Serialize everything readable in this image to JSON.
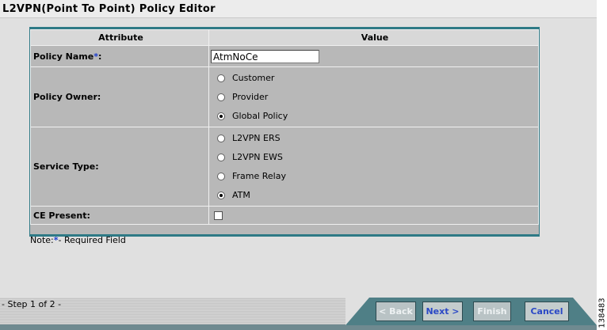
{
  "header": {
    "title": "L2VPN(Point To Point) Policy Editor"
  },
  "table": {
    "col_attribute": "Attribute",
    "col_value": "Value",
    "policy_name": {
      "label": "Policy Name",
      "required_mark": "*",
      "suffix": ":",
      "value": "AtmNoCe"
    },
    "policy_owner": {
      "label": "Policy Owner:",
      "options": [
        {
          "label": "Customer",
          "selected": false
        },
        {
          "label": "Provider",
          "selected": false
        },
        {
          "label": "Global Policy",
          "selected": true
        }
      ]
    },
    "service_type": {
      "label": "Service Type:",
      "options": [
        {
          "label": "L2VPN ERS",
          "selected": false
        },
        {
          "label": "L2VPN EWS",
          "selected": false
        },
        {
          "label": "Frame Relay",
          "selected": false
        },
        {
          "label": "ATM",
          "selected": true
        }
      ]
    },
    "ce_present": {
      "label": "CE Present:",
      "checked": false
    }
  },
  "note": {
    "prefix": "Note:",
    "mark": "*",
    "text": "- Required Field"
  },
  "footer": {
    "step": "- Step 1 of 2 -",
    "buttons": {
      "back": "< Back",
      "next": "Next >",
      "finish": "Finish",
      "cancel": "Cancel"
    }
  },
  "figure_ref": "138483",
  "colors": {
    "frame": "#2e7a86",
    "required": "#1a3ccf",
    "enabled_button_text": "#2a48c6"
  }
}
